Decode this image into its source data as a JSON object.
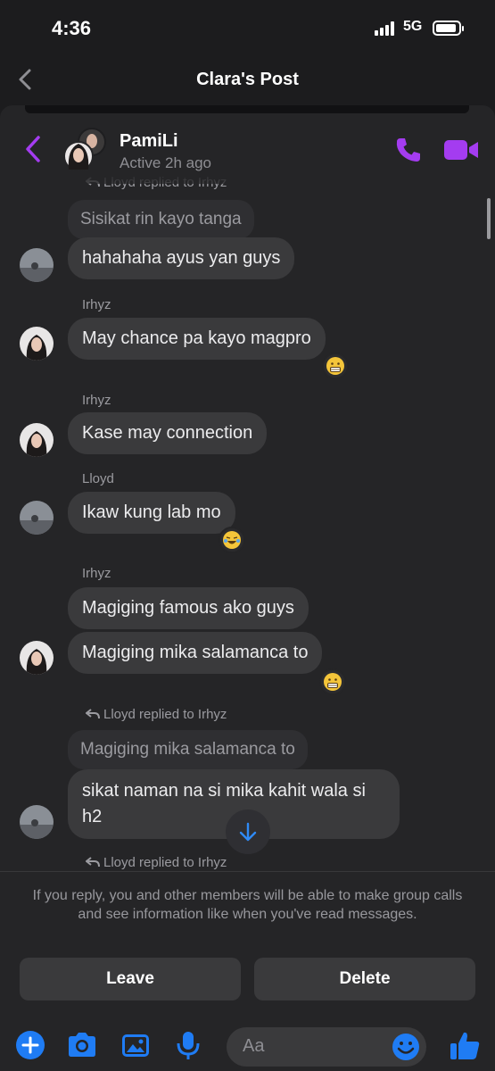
{
  "status_bar": {
    "time": "4:36",
    "network": "5G"
  },
  "nav": {
    "title": "Clara's Post"
  },
  "chat_header": {
    "name": "PamiLi",
    "active": "Active 2h ago"
  },
  "messages": {
    "top_reply_header": "Lloyd replied to Irhyz",
    "m1_quoted": "Sisikat rin kayo tanga",
    "m1_text": "hahahaha ayus yan guys",
    "m2_sender": "Irhyz",
    "m2_text": "May chance pa kayo magpro",
    "m2_reaction": "grimacing-emoji",
    "m3_sender": "Irhyz",
    "m3_text": "Kase may connection",
    "m4_sender": "Lloyd",
    "m4_text": "Ikaw kung lab mo",
    "m4_reaction": "crying-laughing-emoji",
    "m5_sender": "Irhyz",
    "m5_text_a": "Magiging famous ako guys",
    "m5_text_b": "Magiging mika salamanca to",
    "m5_reaction": "grimacing-emoji",
    "m6_reply_header": "Lloyd replied to Irhyz",
    "m6_quoted": "Magiging mika salamanca to",
    "m6_text": "sikat naman na si mika kahit wala si h2",
    "m7_reply_header": "Lloyd replied to Irhyz"
  },
  "footer": {
    "notice": "If you reply, you and other members will be able to make group calls and see information like when you've read messages.",
    "leave_label": "Leave",
    "delete_label": "Delete",
    "input_placeholder": "Aa"
  },
  "colors": {
    "accent_purple": "#a43cf0",
    "messenger_blue": "#1f7cf4",
    "background": "#1c1c1e",
    "bubble": "#3a3a3c"
  }
}
